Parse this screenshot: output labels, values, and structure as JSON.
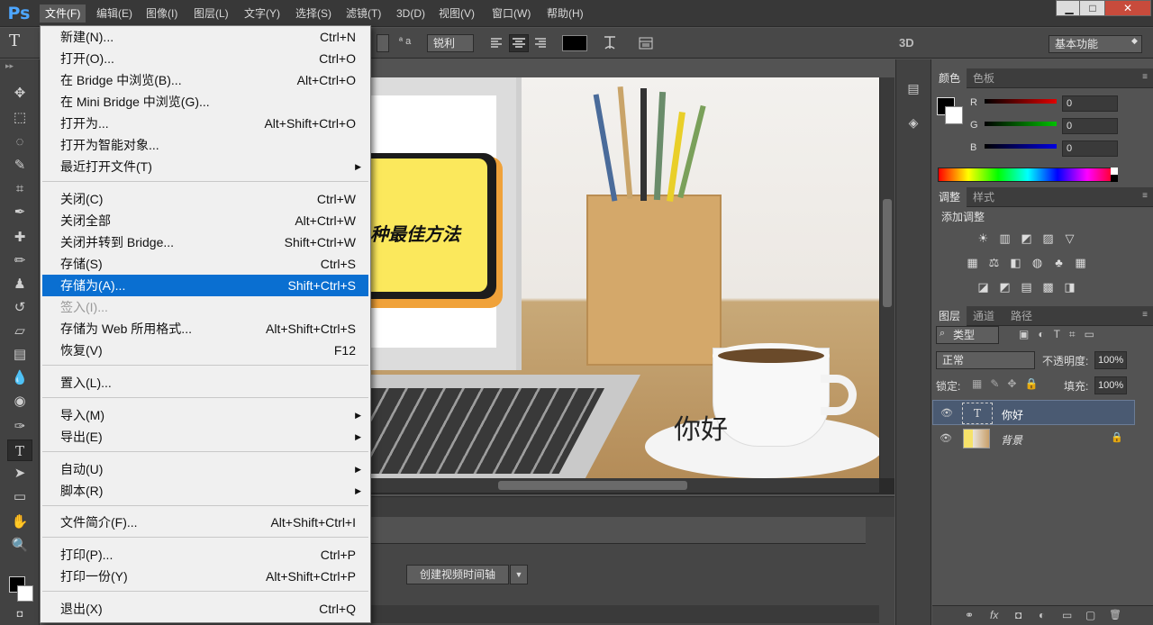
{
  "app": {
    "logo": "Ps"
  },
  "menubar": {
    "items": [
      {
        "label": "文件(F)"
      },
      {
        "label": "编辑(E)"
      },
      {
        "label": "图像(I)"
      },
      {
        "label": "图层(L)"
      },
      {
        "label": "文字(Y)"
      },
      {
        "label": "选择(S)"
      },
      {
        "label": "滤镜(T)"
      },
      {
        "label": "3D(D)"
      },
      {
        "label": "视图(V)"
      },
      {
        "label": "窗口(W)"
      },
      {
        "label": "帮助(H)"
      }
    ]
  },
  "window_controls": {
    "minimize": "▁",
    "maximize": "□",
    "close": "✕"
  },
  "options_bar": {
    "tool_glyph": "T",
    "size_glyph": "ª a",
    "antialias": "锐利",
    "three_d": "3D",
    "workspace": "基本功能"
  },
  "file_menu": {
    "items": [
      {
        "label": "新建(N)...",
        "shortcut": "Ctrl+N"
      },
      {
        "label": "打开(O)...",
        "shortcut": "Ctrl+O"
      },
      {
        "label": "在 Bridge 中浏览(B)...",
        "shortcut": "Alt+Ctrl+O"
      },
      {
        "label": "在 Mini Bridge 中浏览(G)...",
        "shortcut": ""
      },
      {
        "label": "打开为...",
        "shortcut": "Alt+Shift+Ctrl+O"
      },
      {
        "label": "打开为智能对象...",
        "shortcut": ""
      },
      {
        "label": "最近打开文件(T)",
        "shortcut": "",
        "submenu": true
      },
      {
        "label": "关闭(C)",
        "shortcut": "Ctrl+W"
      },
      {
        "label": "关闭全部",
        "shortcut": "Alt+Ctrl+W"
      },
      {
        "label": "关闭并转到 Bridge...",
        "shortcut": "Shift+Ctrl+W"
      },
      {
        "label": "存储(S)",
        "shortcut": "Ctrl+S"
      },
      {
        "label": "存储为(A)...",
        "shortcut": "Shift+Ctrl+S",
        "highlighted": true
      },
      {
        "label": "签入(I)...",
        "shortcut": "",
        "disabled": true
      },
      {
        "label": "存储为 Web 所用格式...",
        "shortcut": "Alt+Shift+Ctrl+S"
      },
      {
        "label": "恢复(V)",
        "shortcut": "F12"
      },
      {
        "label": "置入(L)...",
        "shortcut": ""
      },
      {
        "label": "导入(M)",
        "shortcut": "",
        "submenu": true
      },
      {
        "label": "导出(E)",
        "shortcut": "",
        "submenu": true
      },
      {
        "label": "自动(U)",
        "shortcut": "",
        "submenu": true
      },
      {
        "label": "脚本(R)",
        "shortcut": "",
        "submenu": true
      },
      {
        "label": "文件简介(F)...",
        "shortcut": "Alt+Shift+Ctrl+I"
      },
      {
        "label": "打印(P)...",
        "shortcut": "Ctrl+P"
      },
      {
        "label": "打印一份(Y)",
        "shortcut": "Alt+Shift+Ctrl+P"
      },
      {
        "label": "退出(X)",
        "shortcut": "Ctrl+Q"
      }
    ]
  },
  "canvas": {
    "banner_text": "种最佳方法",
    "overlay_text": "你好"
  },
  "timeline": {
    "create_button": "创建视频时间轴"
  },
  "color_panel": {
    "tabs": [
      "颜色",
      "色板"
    ],
    "channels": [
      {
        "name": "R",
        "value": "0",
        "color": "#e00000"
      },
      {
        "name": "G",
        "value": "0",
        "color": "#00c000"
      },
      {
        "name": "B",
        "value": "0",
        "color": "#0000e0"
      }
    ]
  },
  "adjustments_panel": {
    "tabs": [
      "调整",
      "样式"
    ],
    "title": "添加调整",
    "icons_row1": [
      "☀",
      "▥",
      "◩",
      "▨",
      "▽"
    ],
    "icons_row2": [
      "▦",
      "⚖",
      "◧",
      "◍",
      "♣",
      "▦"
    ],
    "icons_row3": [
      "◪",
      "◩",
      "▤",
      "▩",
      "◨"
    ]
  },
  "layers_panel": {
    "tabs": [
      "图层",
      "通道",
      "路径"
    ],
    "filter_kind": "类型",
    "blend_mode": "正常",
    "opacity_label": "不透明度:",
    "opacity_value": "100%",
    "lock_label": "锁定:",
    "fill_label": "填充:",
    "fill_value": "100%",
    "layers": [
      {
        "name": "你好",
        "type": "text",
        "selected": true
      },
      {
        "name": "背景",
        "type": "image",
        "locked": true
      }
    ],
    "footer_icons": [
      "⚭",
      "fx",
      "◘",
      "◐",
      "▭",
      "▢",
      "🗑"
    ]
  }
}
